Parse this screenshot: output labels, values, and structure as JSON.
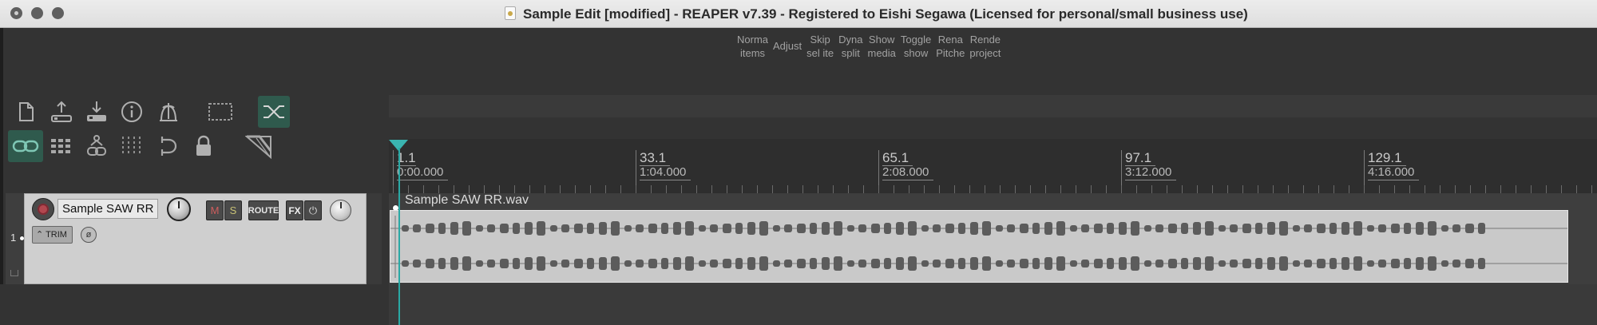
{
  "window": {
    "title": "Sample Edit [modified] - REAPER v7.39 - Registered to Eishi Segawa (Licensed for personal/small business use)"
  },
  "toolbar_actions": [
    {
      "label": "Norma\nitems"
    },
    {
      "label": "Adjust"
    },
    {
      "label": "Skip\nsel ite"
    },
    {
      "label": "Dyna\nsplit"
    },
    {
      "label": "Show\nmedia"
    },
    {
      "label": "Toggle\nshow"
    },
    {
      "label": "Rena\nPitche"
    },
    {
      "label": "Rende\nproject"
    }
  ],
  "main_toolbar": {
    "row1": [
      "new-project-icon",
      "save-upload-icon",
      "save-download-icon",
      "project-info-icon",
      "metronome-icon",
      "marquee-select-icon",
      "crossfade-icon"
    ],
    "row2": [
      "link-icon",
      "grid-icon",
      "group-link-icon",
      "snap-grid-icon",
      "undo-loop-icon",
      "lock-icon",
      "envelope-icon"
    ],
    "active": [
      "crossfade-icon",
      "link-icon"
    ]
  },
  "ruler": {
    "marks": [
      {
        "bar": "1.1",
        "time": "0:00.000"
      },
      {
        "bar": "33.1",
        "time": "1:04.000"
      },
      {
        "bar": "65.1",
        "time": "2:08.000"
      },
      {
        "bar": "97.1",
        "time": "3:12.000"
      },
      {
        "bar": "129.1",
        "time": "4:16.000"
      }
    ]
  },
  "track": {
    "number": "1",
    "name": "Sample SAW RR",
    "mute_label": "M",
    "solo_label": "S",
    "route_label": "ROUTE",
    "fx_label": "FX",
    "power_label": "⏻",
    "trim_label": "TRIM",
    "phase_label": "ø"
  },
  "media_item": {
    "name": "Sample SAW RR.wav"
  },
  "colors": {
    "accent": "#2f5a4d",
    "playhead": "#2aa9a5",
    "record": "#b2474f"
  }
}
